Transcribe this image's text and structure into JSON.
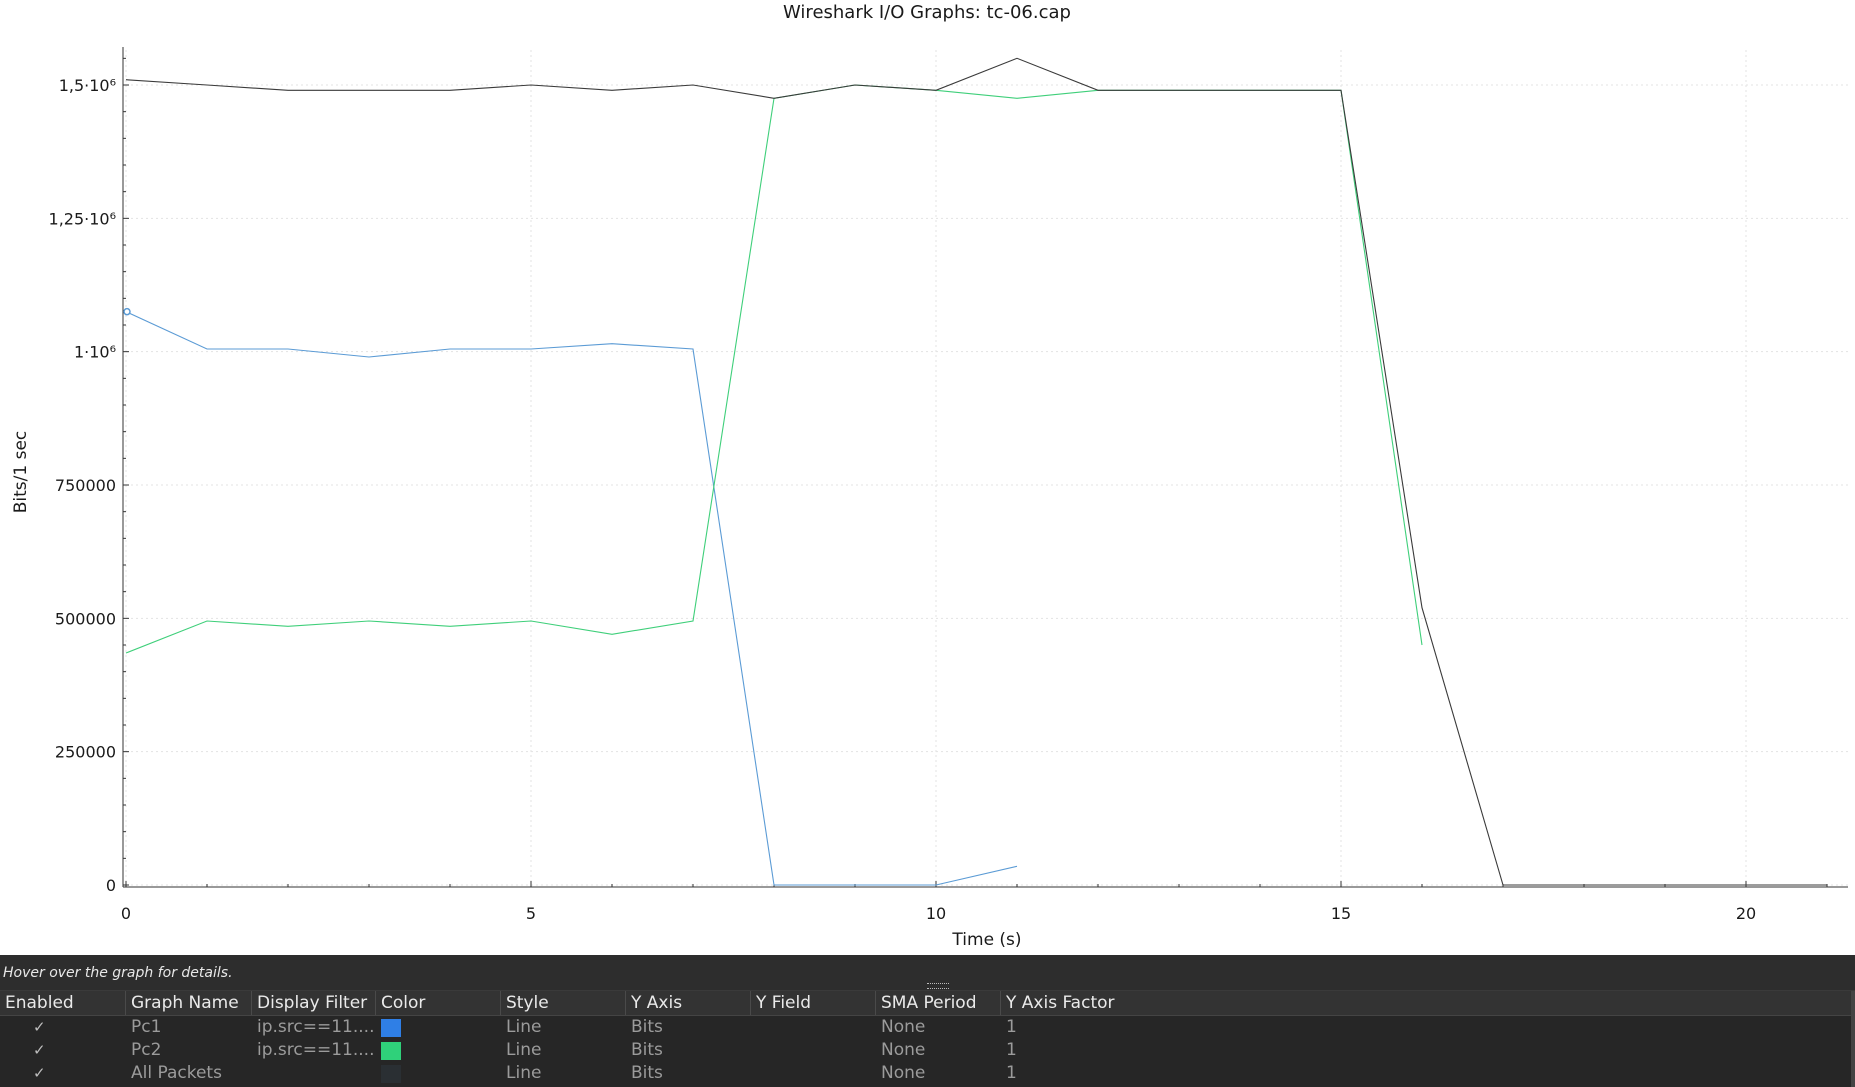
{
  "window": {
    "title": "Wireshark I/O Graphs: tc-06.cap"
  },
  "chart_data": {
    "type": "line",
    "title": "Wireshark I/O Graphs: tc-06.cap",
    "xlabel": "Time (s)",
    "ylabel": "Bits/1 sec",
    "xlim": [
      0,
      21.2
    ],
    "ylim": [
      -20000,
      1600000
    ],
    "x_ticks": [
      0,
      5,
      10,
      15,
      20
    ],
    "x_tick_labels": [
      "0",
      "5",
      "10",
      "15",
      "20"
    ],
    "y_ticks": [
      0,
      250000,
      500000,
      750000,
      1000000,
      1250000,
      1500000
    ],
    "y_tick_labels": [
      "0",
      "250000",
      "500000",
      "750000",
      "1·10⁶",
      "1,25·10⁶",
      "1,5·10⁶"
    ],
    "grid": true,
    "series": [
      {
        "name": "Pc1",
        "color": "#5b9bd5",
        "marker_at_first_point": true,
        "x": [
          0,
          1,
          2,
          3,
          4,
          5,
          6,
          7,
          8,
          9,
          10,
          11
        ],
        "y": [
          1075000,
          1005000,
          1005000,
          990000,
          1005000,
          1005000,
          1015000,
          1005000,
          0,
          0,
          0,
          35000
        ]
      },
      {
        "name": "Pc2",
        "color": "#3fcf7a",
        "x": [
          0,
          1,
          2,
          3,
          4,
          5,
          6,
          7,
          8,
          9,
          10,
          11,
          12,
          13,
          14,
          15,
          16
        ],
        "y": [
          435000,
          495000,
          485000,
          495000,
          485000,
          495000,
          470000,
          495000,
          1475000,
          1500000,
          1490000,
          1475000,
          1490000,
          1490000,
          1490000,
          1490000,
          450000
        ]
      },
      {
        "name": "All Packets",
        "color": "#3a3a3a",
        "x": [
          0,
          1,
          2,
          3,
          4,
          5,
          6,
          7,
          8,
          9,
          10,
          11,
          12,
          13,
          14,
          15,
          16,
          17,
          18,
          19,
          20,
          21
        ],
        "y": [
          1510000,
          1500000,
          1490000,
          1490000,
          1490000,
          1500000,
          1490000,
          1500000,
          1475000,
          1500000,
          1490000,
          1550000,
          1490000,
          1490000,
          1490000,
          1490000,
          520000,
          0,
          0,
          0,
          0,
          0
        ]
      }
    ]
  },
  "panel": {
    "hint": "Hover over the graph for details.",
    "columns": [
      "Enabled",
      "Graph Name",
      "Display Filter",
      "Color",
      "Style",
      "Y Axis",
      "Y Field",
      "SMA Period",
      "Y Axis Factor"
    ],
    "rows": [
      {
        "enabled": "✓",
        "name": "Pc1",
        "filter": "ip.src==11....",
        "color": "#2f7fe6",
        "style": "Line",
        "y_axis": "Bits",
        "y_field": "",
        "sma": "None",
        "factor": "1"
      },
      {
        "enabled": "✓",
        "name": "Pc2",
        "filter": "ip.src==11....",
        "color": "#2fd17a",
        "style": "Line",
        "y_axis": "Bits",
        "y_field": "",
        "sma": "None",
        "factor": "1"
      },
      {
        "enabled": "✓",
        "name": "All Packets",
        "filter": "",
        "color": "#2a2f33",
        "style": "Line",
        "y_axis": "Bits",
        "y_field": "",
        "sma": "None",
        "factor": "1"
      }
    ]
  }
}
